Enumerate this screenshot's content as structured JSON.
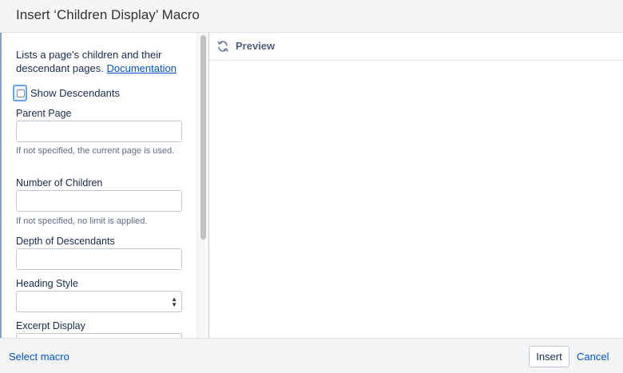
{
  "dialog": {
    "title": "Insert ‘Children Display’ Macro"
  },
  "form": {
    "description": "Lists a page's children and their descendant pages.",
    "documentation_link": "Documentation",
    "show_descendants": {
      "label": "Show Descendants",
      "checked": false
    },
    "parent_page": {
      "label": "Parent Page",
      "value": "",
      "hint": "If not specified, the current page is used."
    },
    "number_of_children": {
      "label": "Number of Children",
      "value": "",
      "hint": "If not specified, no limit is applied."
    },
    "depth_of_descendants": {
      "label": "Depth of Descendants",
      "value": ""
    },
    "heading_style": {
      "label": "Heading Style",
      "selected": ""
    },
    "excerpt_display": {
      "label": "Excerpt Display"
    }
  },
  "preview": {
    "label": "Preview",
    "icon": "refresh-icon"
  },
  "footer": {
    "select_macro": "Select macro",
    "insert": "Insert",
    "cancel": "Cancel"
  },
  "colors": {
    "link": "#0052cc",
    "header_bg": "#f4f5f7",
    "focus_ring": "#6ca3e6"
  }
}
